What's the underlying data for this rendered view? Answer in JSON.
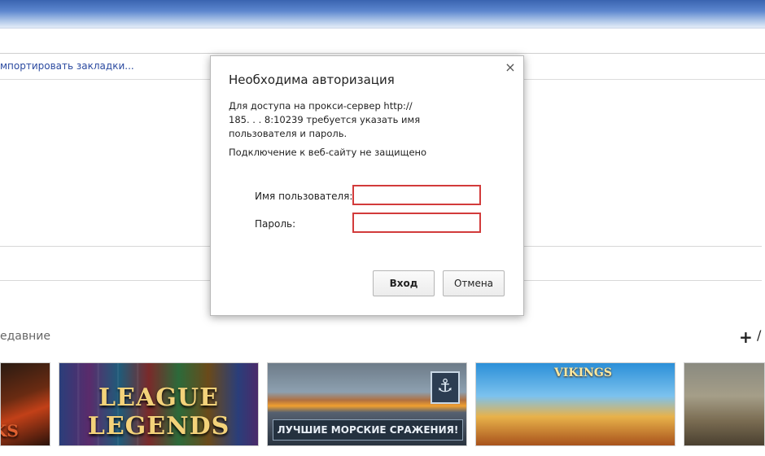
{
  "browser": {
    "import_bookmarks": "мпортировать закладки..."
  },
  "ntp": {
    "recent_label": "едавние",
    "plus": "+",
    "more": "/",
    "tiles": [
      {
        "caption": "KS"
      },
      {
        "caption": "LEAGUE LEGENDS"
      },
      {
        "caption": "ЛУЧШИЕ МОРСКИЕ СРАЖЕНИЯ!"
      },
      {
        "caption": "VIKINGS"
      },
      {
        "caption": ""
      }
    ]
  },
  "dialog": {
    "title": "Необходима авторизация",
    "message_line1": "Для доступа на прокси-сервер http://",
    "message_line2": "185.      .      .      8:10239 требуется указать имя",
    "message_line3": "пользователя и пароль.",
    "warning": "Подключение к веб-сайту не защищено",
    "username_label": "Имя пользователя:",
    "username_value": "",
    "password_label": "Пароль:",
    "password_value": "",
    "login_button": "Вход",
    "cancel_button": "Отмена",
    "close_glyph": "×",
    "field_highlight_color": "#d23b3b"
  }
}
